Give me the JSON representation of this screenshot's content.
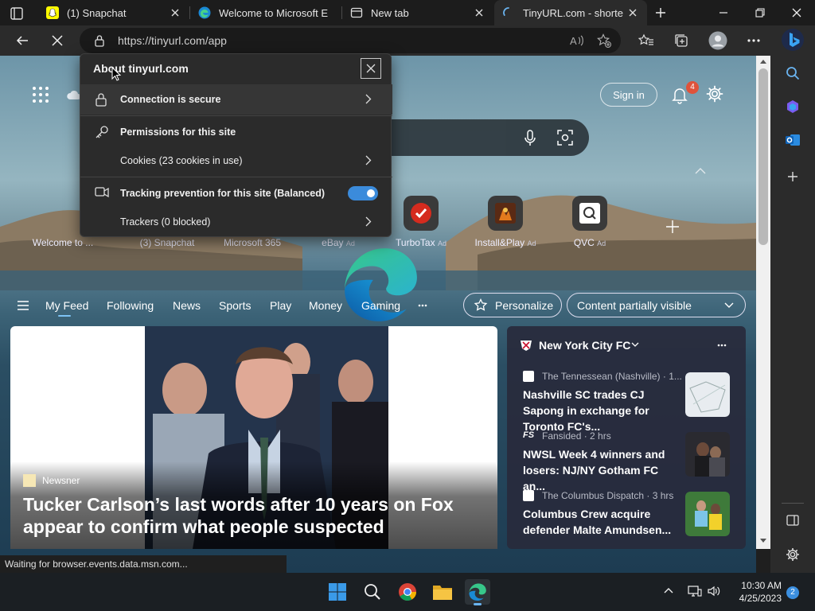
{
  "tabs": [
    {
      "title": "(1) Snapchat"
    },
    {
      "title": "Welcome to Microsoft E"
    },
    {
      "title": "New tab"
    },
    {
      "title": "TinyURL.com - shorten"
    }
  ],
  "toolbar": {
    "url": "https://tinyurl.com/app"
  },
  "popup": {
    "title": "About tinyurl.com",
    "connection": "Connection is secure",
    "permissions": "Permissions for this site",
    "cookies": "Cookies (23 cookies in use)",
    "tracking": "Tracking prevention for this site (Balanced)",
    "tracking_enabled": true,
    "trackers": "Trackers (0 blocked)"
  },
  "header": {
    "sign_in": "Sign in",
    "notification_count": "4"
  },
  "tiles": [
    {
      "label": "Welcome to ...",
      "ad": ""
    },
    {
      "label": "(3) Snapchat",
      "ad": ""
    },
    {
      "label": "Microsoft 365",
      "ad": ""
    },
    {
      "label": "eBay",
      "ad": "Ad"
    },
    {
      "label": "TurboTax",
      "ad": "Ad"
    },
    {
      "label": "Install&Play",
      "ad": "Ad"
    },
    {
      "label": "QVC",
      "ad": "Ad"
    }
  ],
  "feed_nav": [
    "My Feed",
    "Following",
    "News",
    "Sports",
    "Play",
    "Money",
    "Gaming"
  ],
  "feed_controls": {
    "personalize": "Personalize",
    "content_visibility": "Content partially visible"
  },
  "hero": {
    "source": "Newsner",
    "headline": "Tucker Carlson’s last words after 10 years on Fox appear to confirm what people suspected"
  },
  "side_card": {
    "team": "New York City FC",
    "items": [
      {
        "source": "The Tennessean (Nashville) · 1...",
        "headline": "Nashville SC trades CJ Sapong in exchange for Toronto FC's..."
      },
      {
        "source": "Fansided · 2 hrs",
        "headline": "NWSL Week 4 winners and losers: NJ/NY Gotham FC an..."
      },
      {
        "source": "The Columbus Dispatch · 3 hrs",
        "headline": "Columbus Crew acquire defender Malte Amundsen..."
      }
    ]
  },
  "status_bar": "Waiting for browser.events.data.msn.com...",
  "taskbar": {
    "time": "10:30 AM",
    "date": "4/25/2023",
    "notifications": "2"
  },
  "colors": {
    "accent": "#3b8bdb",
    "notification_badge": "#e0533b"
  }
}
